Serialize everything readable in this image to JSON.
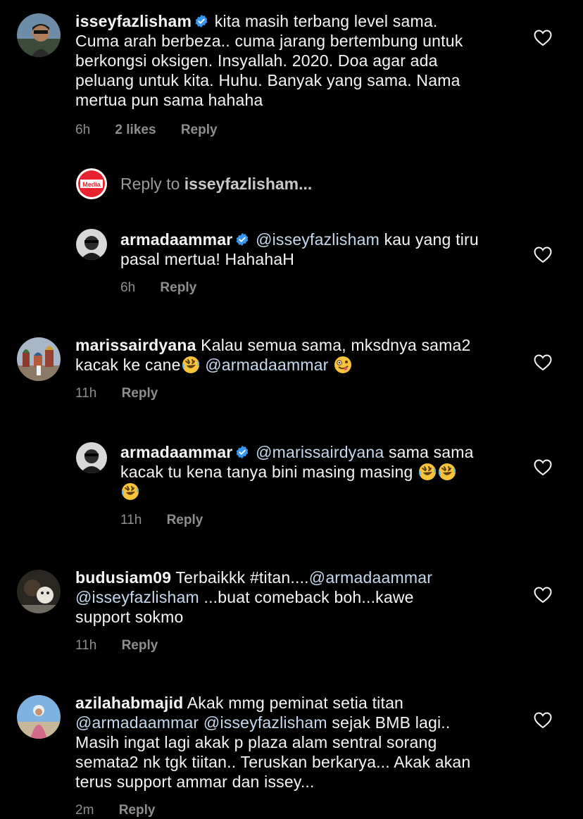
{
  "comments": [
    {
      "username": "isseyfazlisham",
      "text": "kita masih terbang level sama.",
      "lines": [
        "Cuma arah berbeza.. cuma jarang bertembung untuk",
        "berkongsi oksigen. Insyallah. 2020. Doa agar ada",
        "peluang untuk kita. Huhu. Banyak yang sama. Nama",
        "mertua pun sama hahaha"
      ],
      "time": "6h",
      "likes": "2 likes",
      "reply": "Reply"
    },
    {
      "reply_prompt": "Reply to",
      "reply_user": "isseyfazlisham...",
      "avatar_badge": "Media"
    },
    {
      "username": "armadaammar",
      "mention": "@isseyfazlisham",
      "text": "kau yang tiru",
      "line2": "pasal mertua! HahahaH",
      "time": "6h",
      "reply": "Reply"
    },
    {
      "username": "marissairdyana",
      "text": "Kalau semua sama, mksdnya sama2",
      "line2a": "kacak ke cane",
      "mention": "@armadaammar",
      "time": "11h",
      "reply": "Reply"
    },
    {
      "username": "armadaammar",
      "mention": "@marissairdyana",
      "text": "sama sama",
      "line2": "kacak tu kena tanya bini masing masing",
      "time": "11h",
      "reply": "Reply"
    },
    {
      "username": "budusiam09",
      "text": "Terbaikkk #titan....",
      "mention1": "@armadaammar",
      "mention2": "@isseyfazlisham",
      "line2rest": "...buat comeback boh...kawe",
      "line3": "support sokmo",
      "time": "11h",
      "reply": "Reply"
    },
    {
      "username": "azilahabmajid",
      "text": "Akak mmg peminat setia titan",
      "mention1": "@armadaammar",
      "mention2": "@isseyfazlisham",
      "line2rest": "sejak BMB lagi..",
      "lines": [
        "Masih ingat lagi akak p plaza alam sentral sorang",
        "semata2 nk tgk tiitan.. Teruskan berkarya... Akak akan",
        "terus support ammar dan issey..."
      ],
      "time": "2m",
      "reply": "Reply"
    }
  ],
  "colors": {
    "background": "#000000",
    "text": "#f5f5f5",
    "meta": "#8e8e8e",
    "mention": "#c7d7ee",
    "verified": "#3897f0"
  }
}
